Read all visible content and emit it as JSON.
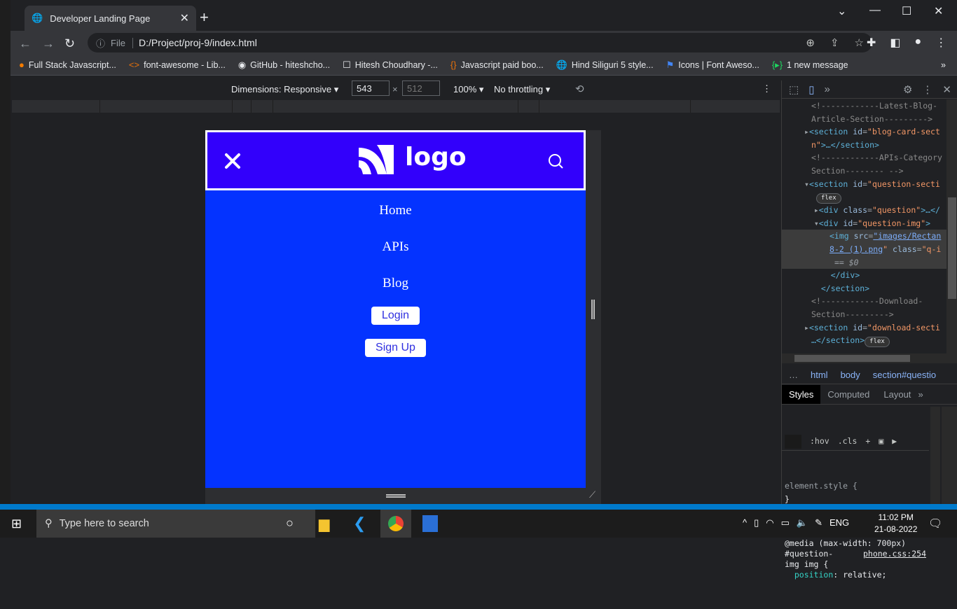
{
  "browser": {
    "tab_title": "Developer Landing Page",
    "address_prefix": "File",
    "url": "D:/Project/proj-9/index.html"
  },
  "bookmarks": [
    {
      "label": "Full Stack Javascript...",
      "icon": "orange-circle-icon",
      "color": "#f57c00"
    },
    {
      "label": "font-awesome - Lib...",
      "icon": "code-brackets-icon",
      "color": "#e8710a"
    },
    {
      "label": "GitHub - hiteshcho...",
      "icon": "github-icon",
      "color": "#ffffff"
    },
    {
      "label": "Hitesh Choudhary -...",
      "icon": "page-icon",
      "color": "#ffffff"
    },
    {
      "label": "Javascript paid boo...",
      "icon": "braces-icon",
      "color": "#e8710a"
    },
    {
      "label": "Hind Siliguri 5 style...",
      "icon": "globe-icon",
      "color": "#9aa0a6"
    },
    {
      "label": "Icons | Font Aweso...",
      "icon": "flag-icon",
      "color": "#4285f4"
    },
    {
      "label": "1 new message",
      "icon": "play-braces-icon",
      "color": "#1ed760"
    }
  ],
  "device_toolbar": {
    "dimensions_label": "Dimensions: Responsive",
    "width": "543",
    "height": "512",
    "zoom": "100%",
    "throttling": "No throttling"
  },
  "page": {
    "logo_text": "logo",
    "header_color": "#3200fb",
    "menu_color": "#0433ff",
    "menu": [
      "Home",
      "APIs",
      "Blog"
    ],
    "login": "Login",
    "signup": "Sign Up"
  },
  "devtools": {
    "breadcrumb": [
      "html",
      "body",
      "section#questio"
    ],
    "tabs": [
      "Styles",
      "Computed",
      "Layout"
    ],
    "filter": {
      "hov": ":hov",
      "cls": ".cls"
    },
    "element_style": "element.style {",
    "close_brace": "}",
    "media": "@media (max-width: 700px)",
    "selector1": "#question-",
    "selector2": "img img {",
    "source": "phone.css:254",
    "prop": "position",
    "propval": "relative;"
  },
  "taskbar": {
    "search_placeholder": "Type here to search",
    "time": "11:02 PM",
    "date": "21-08-2022",
    "lang": "ENG"
  }
}
